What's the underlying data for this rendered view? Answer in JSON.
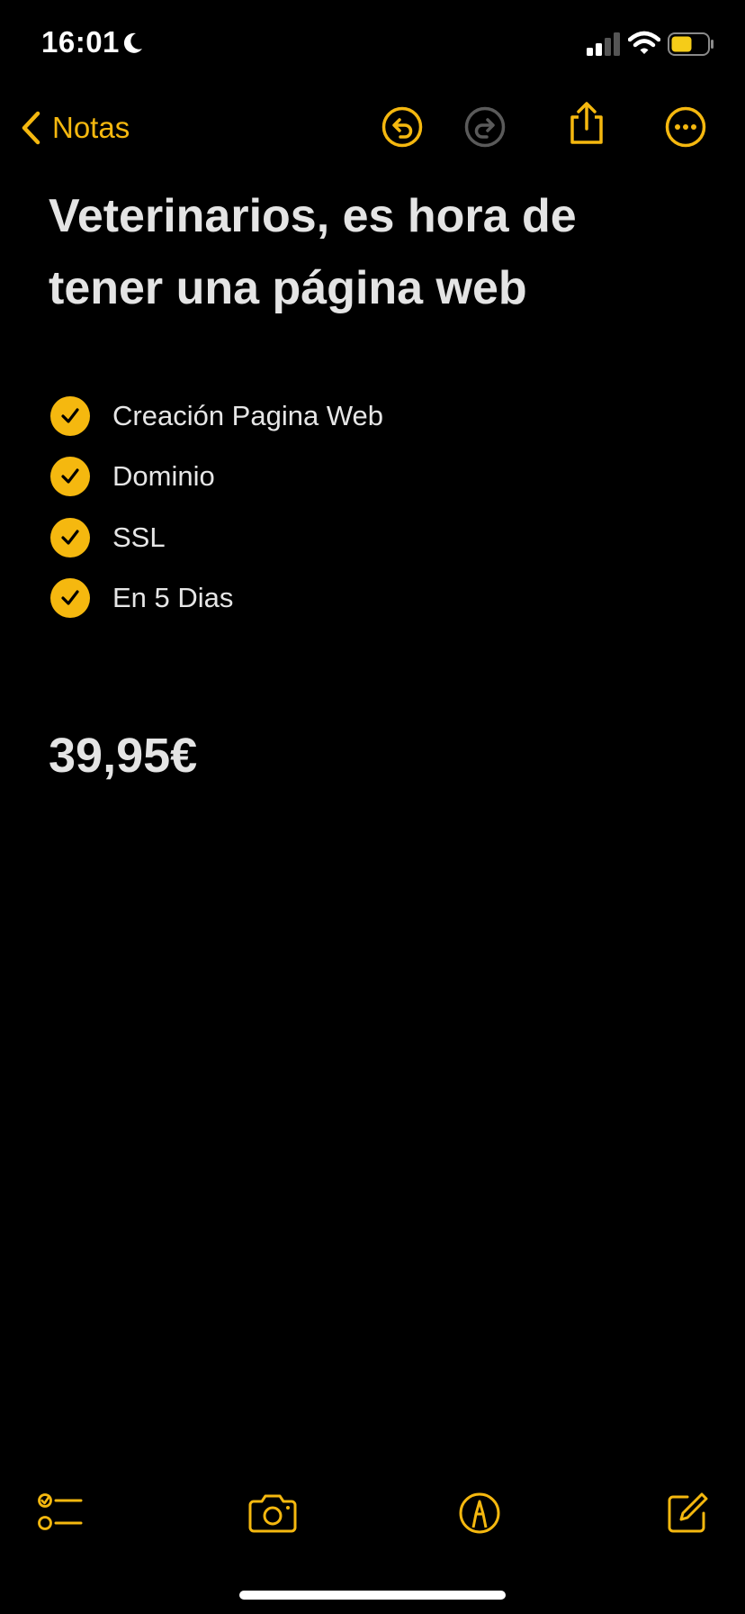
{
  "status_bar": {
    "time": "16:01",
    "icons": [
      "moon-icon",
      "cellular-signal-icon",
      "wifi-icon",
      "battery-icon"
    ]
  },
  "nav": {
    "back_label": "Notas",
    "icons": [
      "chevron-left-icon",
      "undo-icon",
      "redo-icon",
      "share-icon",
      "more-icon"
    ]
  },
  "note": {
    "title": "Veterinarios, es hora de tener una página web",
    "checklist": [
      {
        "text": "Creación Pagina Web",
        "checked": true
      },
      {
        "text": "Dominio",
        "checked": true
      },
      {
        "text": "SSL",
        "checked": true
      },
      {
        "text": "En 5 Dias",
        "checked": true
      }
    ],
    "price": "39,95€"
  },
  "bottom_toolbar": {
    "icons": [
      "checklist-icon",
      "camera-icon",
      "markup-icon",
      "compose-icon"
    ]
  },
  "colors": {
    "accent": "#f5b80f",
    "background": "#000000",
    "text": "#e6e6e6",
    "disabled": "#5a5a5a"
  }
}
